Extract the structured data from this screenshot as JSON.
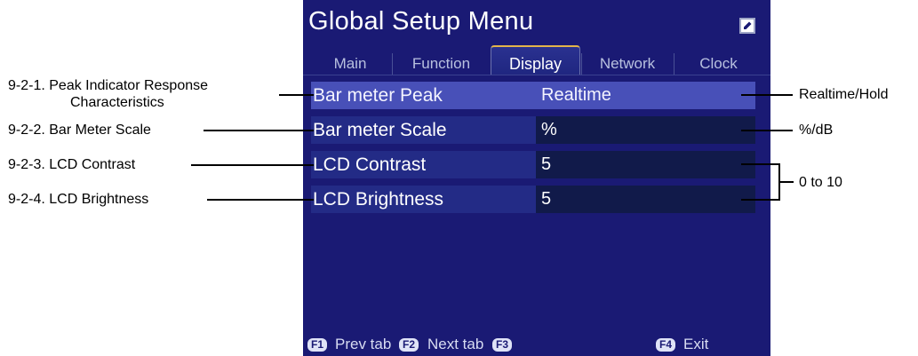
{
  "screen": {
    "title": "Global Setup Menu",
    "tabs": [
      {
        "label": "Main",
        "active": false
      },
      {
        "label": "Function",
        "active": false
      },
      {
        "label": "Display",
        "active": true
      },
      {
        "label": "Network",
        "active": false
      },
      {
        "label": "Clock",
        "active": false
      }
    ],
    "rows": [
      {
        "label": "Bar meter Peak",
        "value": "Realtime",
        "selected": true
      },
      {
        "label": "Bar meter Scale",
        "value": "%",
        "selected": false
      },
      {
        "label": "LCD Contrast",
        "value": "5",
        "selected": false
      },
      {
        "label": "LCD Brightness",
        "value": "5",
        "selected": false
      }
    ],
    "footer": {
      "f1_key": "F1",
      "f1_label": "Prev tab",
      "f2_key": "F2",
      "f2_label": "Next tab",
      "f3_key": "F3",
      "f4_key": "F4",
      "f4_label": "Exit"
    }
  },
  "callouts": {
    "peak_line1": "9-2-1. Peak Indicator Response",
    "peak_line2": "Characteristics",
    "scale": "9-2-2. Bar Meter Scale",
    "contrast": "9-2-3. LCD Contrast",
    "brightness": "9-2-4. LCD Brightness",
    "peak_options": "Realtime/Hold",
    "scale_options": "%/dB",
    "range": "0 to 10"
  },
  "colors": {
    "screen_bg": "#1a1a74",
    "selected_row": "#4850b8",
    "value_bg": "#111a4a",
    "tab_accent": "#e3b44a"
  }
}
